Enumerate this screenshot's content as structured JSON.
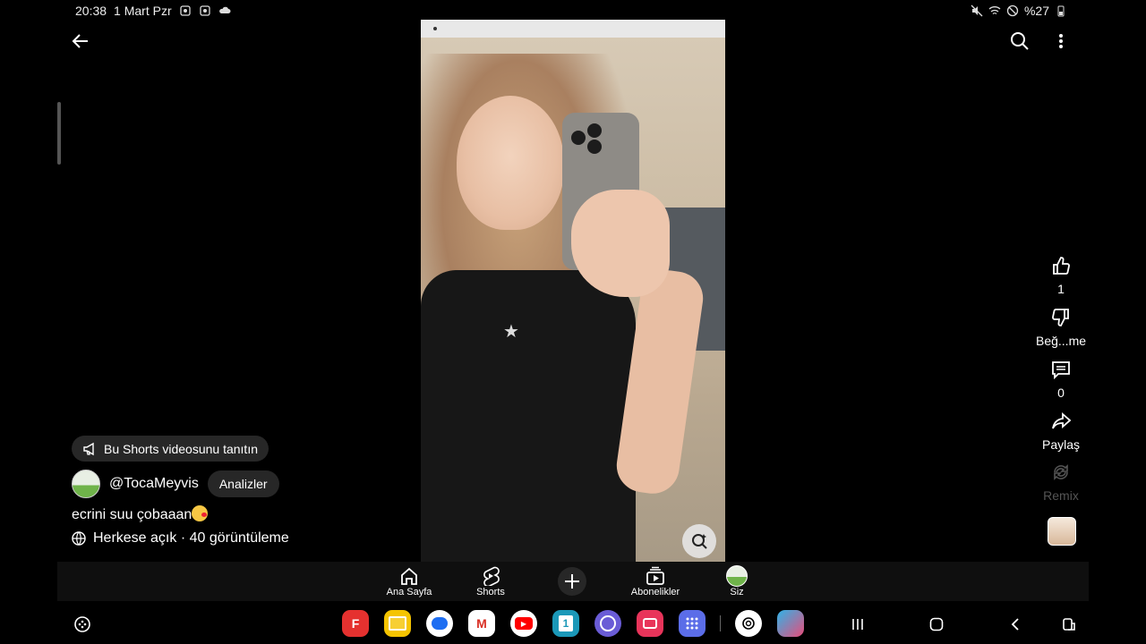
{
  "status_bar": {
    "time": "20:38",
    "date": "1 Mart Pzr",
    "battery": "%27"
  },
  "icons": {
    "back": "arrow-left-icon",
    "search": "search-icon",
    "more": "more-vertical-icon"
  },
  "actions": {
    "like_count": "1",
    "dislike_label": "Beğ...me",
    "comment_count": "0",
    "share_label": "Paylaş",
    "remix_label": "Remix"
  },
  "info": {
    "promo_label": "Bu Shorts videosunu tanıtın",
    "channel": "@TocaMeyvis",
    "analytics_label": "Analizler",
    "caption": "ecrini suu çobaaan",
    "visibility": "Herkese açık · 40 görüntüleme"
  },
  "nav": [
    {
      "label": "Ana Sayfa",
      "icon": "home-icon"
    },
    {
      "label": "Shorts",
      "icon": "shorts-icon"
    },
    {
      "label": "Abonelikler",
      "icon": "subscriptions-icon"
    },
    {
      "label": "Siz",
      "icon": "profile-icon"
    }
  ],
  "dock_apps": [
    {
      "name": "flipboard",
      "color": "#e5312f",
      "glyph": "F"
    },
    {
      "name": "files",
      "color": "#f5c400",
      "glyph": ""
    },
    {
      "name": "messages",
      "color": "#1e6ef2",
      "glyph": ""
    },
    {
      "name": "gmail",
      "color": "#ffffff",
      "glyph": "M"
    },
    {
      "name": "youtube",
      "color": "#ff0000",
      "glyph": "▶"
    },
    {
      "name": "calendar",
      "color": "#1b98b8",
      "glyph": "1"
    },
    {
      "name": "internet",
      "color": "#6a5cd6",
      "glyph": ""
    },
    {
      "name": "camera",
      "color": "#e8345a",
      "glyph": ""
    },
    {
      "name": "apps",
      "color": "#5b6de8",
      "glyph": "⋮⋮"
    },
    {
      "name": "chatgpt",
      "color": "#ffffff",
      "glyph": ""
    },
    {
      "name": "game",
      "color": "#2fb3e8",
      "glyph": ""
    }
  ]
}
